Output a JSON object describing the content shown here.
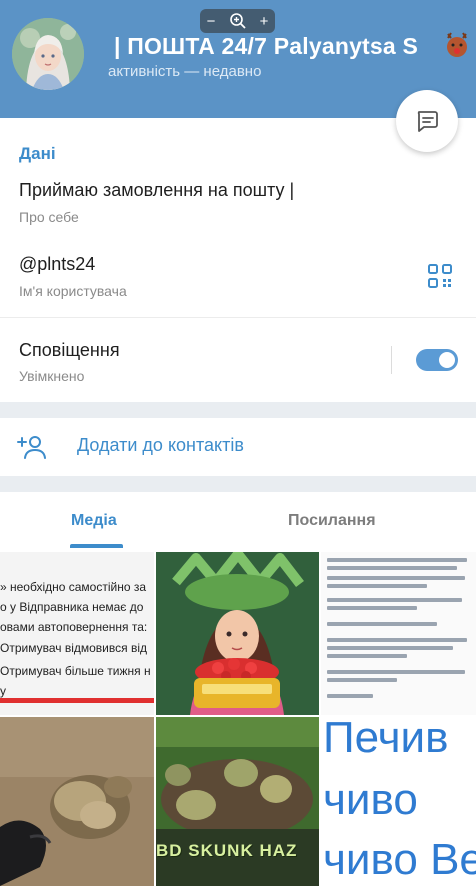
{
  "header": {
    "title": "| ПОШТА 24/7   Palyanytsa S",
    "status": "активність — недавно",
    "zoom": {
      "minus": "−",
      "plus": "+"
    },
    "color": "#5b93c6"
  },
  "info": {
    "section_title": "Дані",
    "bio": {
      "value": "Приймаю замовлення на пошту |",
      "label": "Про себе"
    },
    "username": {
      "value": "@plnts24",
      "label": "Ім'я користувача"
    },
    "notifications": {
      "value": "Сповіщення",
      "label": "Увімкнено",
      "enabled": true
    }
  },
  "actions": {
    "add_contact": "Додати до контактів"
  },
  "tabs": [
    {
      "label": "Медіа",
      "active": true
    },
    {
      "label": "Посилання",
      "active": false
    }
  ],
  "media": {
    "tile1_lines": [
      "» необхідно самостійно за",
      "о у Відправника немає до",
      "овами автоповернення та:",
      "",
      "Отримувач відмовився від",
      "Отримувач більше тижня н",
      "у"
    ],
    "tile5_overlay": "BD SKUNK HAZ",
    "tile6_lines": [
      "Печив",
      "чиво",
      "чиво Ве"
    ]
  },
  "accent_color": "#3d8ccb"
}
